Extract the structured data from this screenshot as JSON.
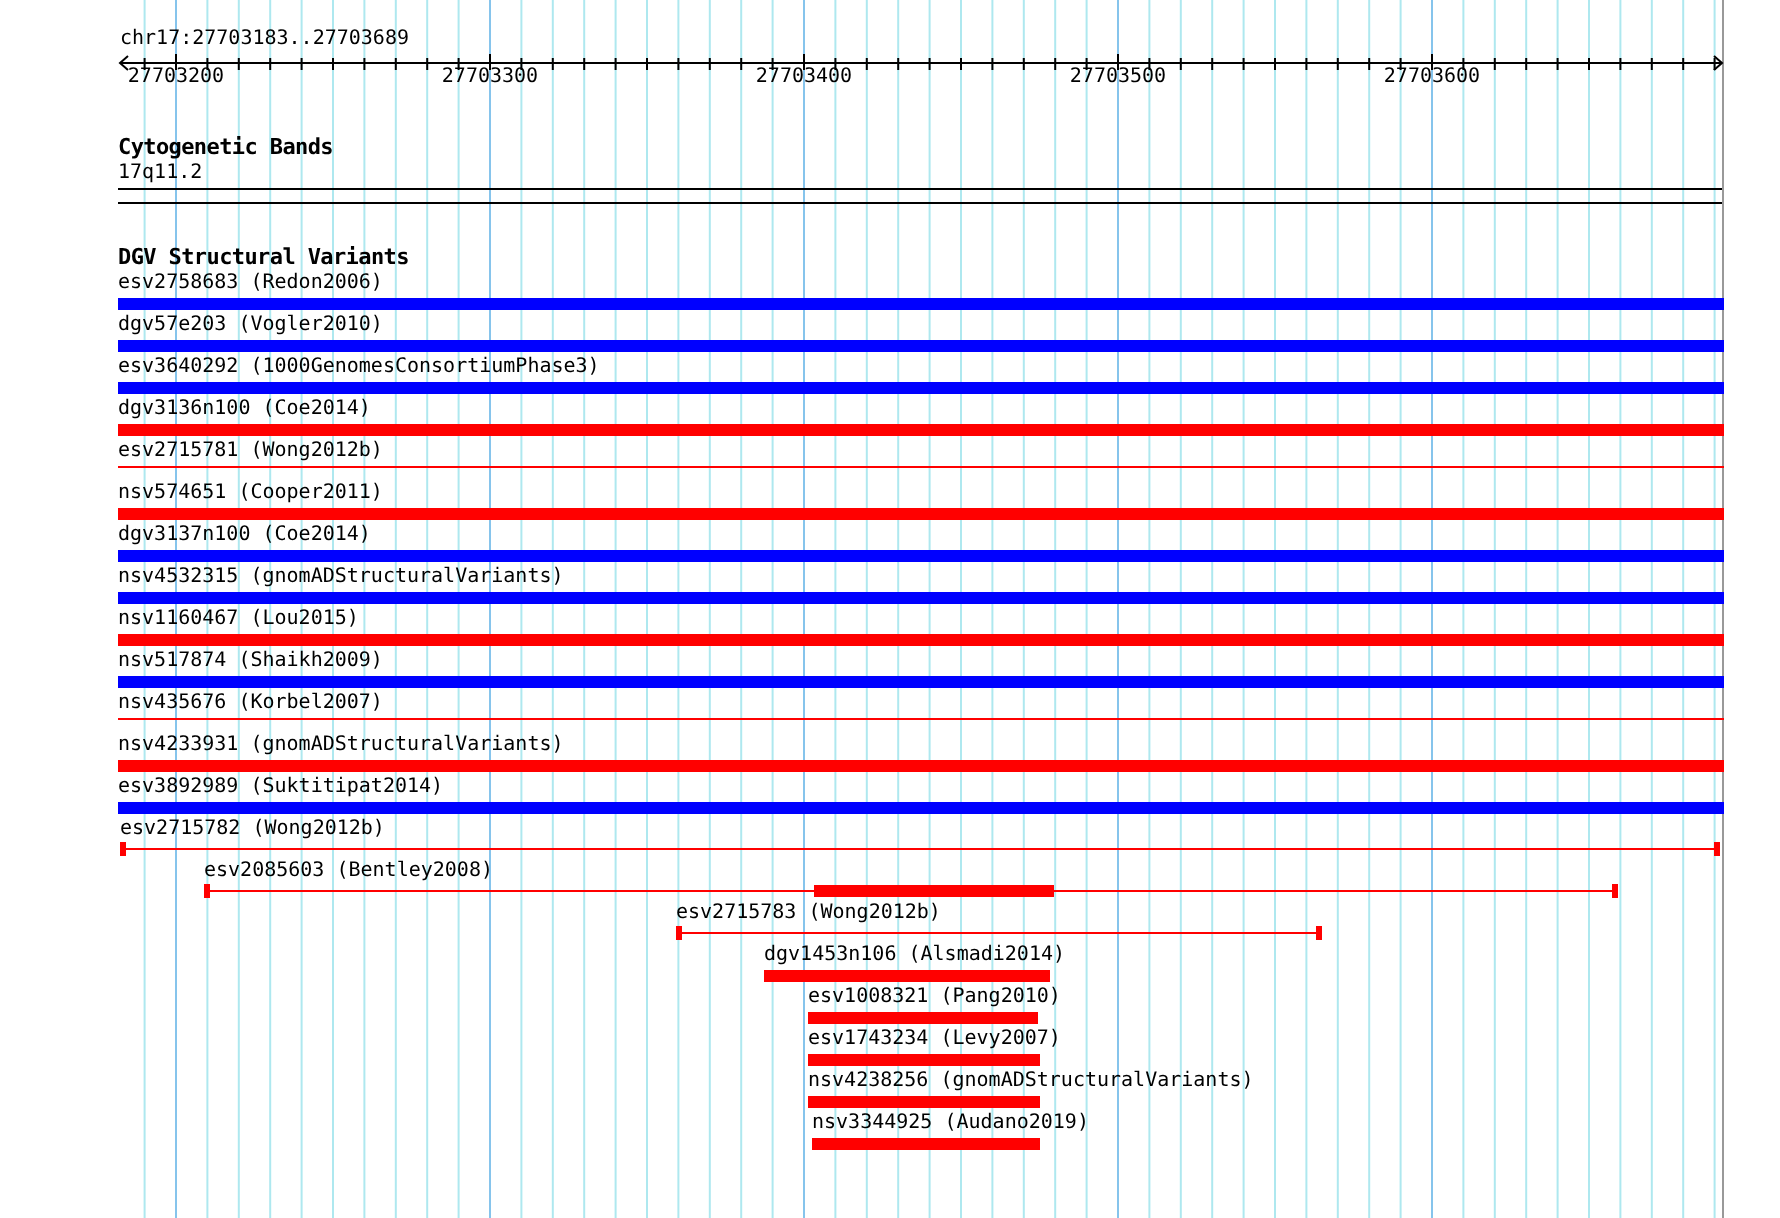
{
  "ruler": {
    "title": "chr17:27703183..27703689",
    "ticks": [
      "27703200",
      "27703300",
      "27703400",
      "27703500",
      "27703600"
    ]
  },
  "cytogenetic_bands": {
    "title": "Cytogenetic Bands",
    "band": "17q11.2"
  },
  "dgv_structural_variants": {
    "title": "DGV Structural Variants",
    "features": [
      {
        "label": "esv2758683 (Redon2006)",
        "color": "#0000ff",
        "kind": "block"
      },
      {
        "label": "dgv57e203 (Vogler2010)",
        "color": "#0000ff",
        "kind": "block"
      },
      {
        "label": "esv3640292 (1000GenomesConsortiumPhase3)",
        "color": "#0000ff",
        "kind": "block"
      },
      {
        "label": "dgv3136n100 (Coe2014)",
        "color": "#ff0000",
        "kind": "block"
      },
      {
        "label": "esv2715781 (Wong2012b)",
        "color": "#ff0000",
        "kind": "line"
      },
      {
        "label": "nsv574651 (Cooper2011)",
        "color": "#ff0000",
        "kind": "block"
      },
      {
        "label": "dgv3137n100 (Coe2014)",
        "color": "#0000ff",
        "kind": "block"
      },
      {
        "label": "nsv4532315 (gnomADStructuralVariants)",
        "color": "#0000ff",
        "kind": "block"
      },
      {
        "label": "nsv1160467 (Lou2015)",
        "color": "#ff0000",
        "kind": "block"
      },
      {
        "label": "nsv517874 (Shaikh2009)",
        "color": "#0000ff",
        "kind": "block"
      },
      {
        "label": "nsv435676 (Korbel2007)",
        "color": "#ff0000",
        "kind": "line"
      },
      {
        "label": "nsv4233931 (gnomADStructuralVariants)",
        "color": "#ff0000",
        "kind": "block"
      },
      {
        "label": "esv3892989 (Suktitipat2014)",
        "color": "#0000ff",
        "kind": "block"
      },
      {
        "label": "esv2715782 (Wong2012b)",
        "color": "#ff0000",
        "kind": "span"
      },
      {
        "label": "esv2085603 (Bentley2008)",
        "color": "#ff0000",
        "kind": "span-core"
      },
      {
        "label": "esv2715783 (Wong2012b)",
        "color": "#ff0000",
        "kind": "span"
      },
      {
        "label": "dgv1453n106 (Alsmadi2014)",
        "color": "#ff0000",
        "kind": "block"
      },
      {
        "label": "esv1008321 (Pang2010)",
        "color": "#ff0000",
        "kind": "block"
      },
      {
        "label": "esv1743234 (Levy2007)",
        "color": "#ff0000",
        "kind": "block"
      },
      {
        "label": "nsv4238256 (gnomADStructuralVariants)",
        "color": "#ff0000",
        "kind": "block"
      },
      {
        "label": "nsv3344925 (Audano2019)",
        "color": "#ff0000",
        "kind": "block"
      }
    ]
  }
}
